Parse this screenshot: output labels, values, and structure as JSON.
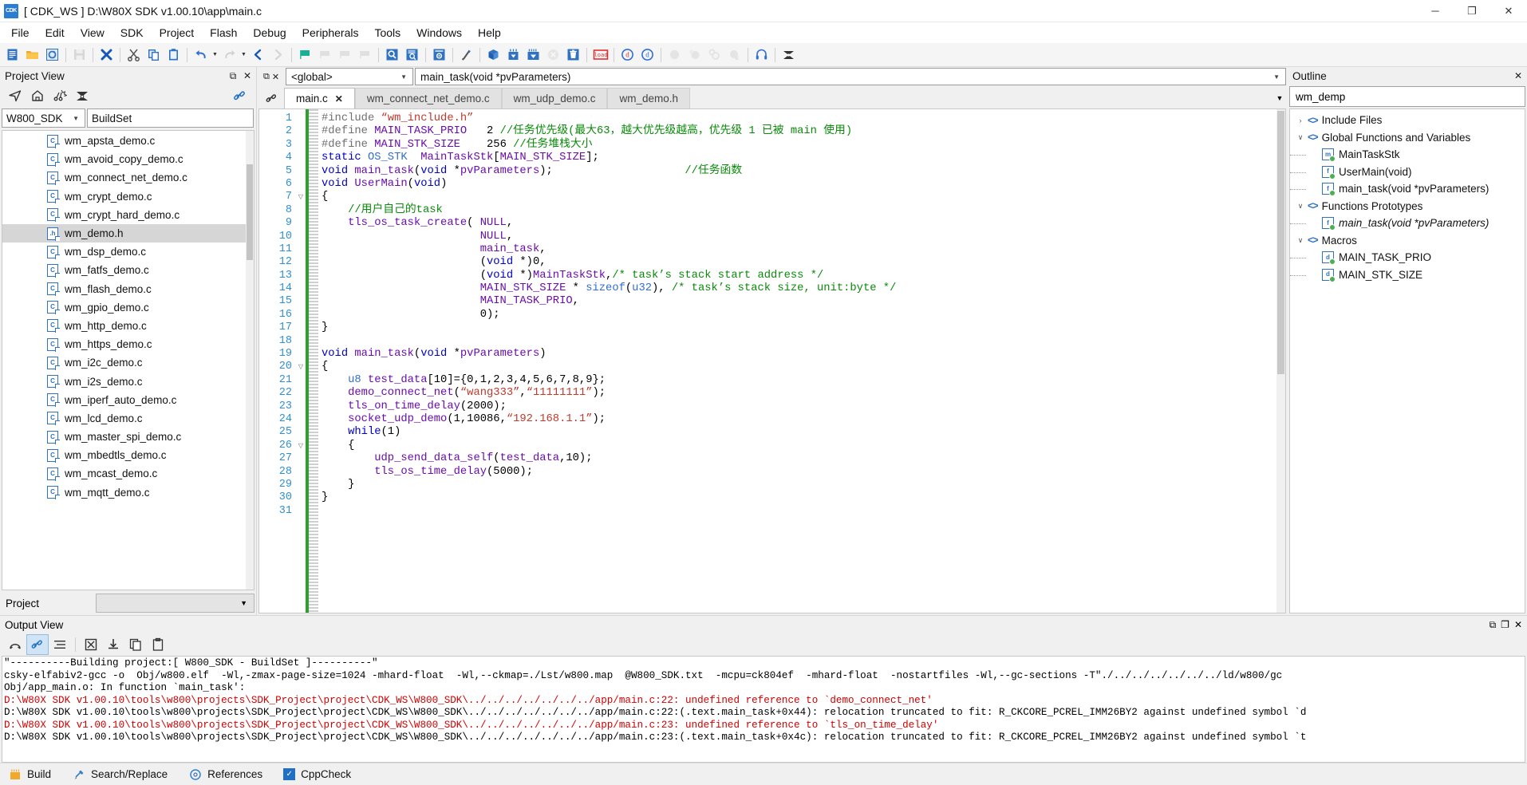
{
  "window": {
    "title": "[ CDK_WS ] D:\\W80X SDK v1.00.10\\app\\main.c",
    "app_icon_text": "CDK",
    "minimize": "─",
    "maximize": "❐",
    "close": "✕"
  },
  "menu": [
    "File",
    "Edit",
    "View",
    "SDK",
    "Project",
    "Flash",
    "Debug",
    "Peripherals",
    "Tools",
    "Windows",
    "Help"
  ],
  "project_view": {
    "title": "Project View",
    "dock_icon": "⧉",
    "close_icon": "✕",
    "toolbar": [
      "navigate-icon",
      "home-icon",
      "build-icon",
      "target-icon",
      "link-icon"
    ],
    "sdk_combo": "W800_SDK",
    "buildset_combo": "BuildSet",
    "bottom_label": "Project",
    "files": [
      {
        "name": "wm_apsta_demo.c",
        "type": "c",
        "selected": false
      },
      {
        "name": "wm_avoid_copy_demo.c",
        "type": "c",
        "selected": false
      },
      {
        "name": "wm_connect_net_demo.c",
        "type": "c",
        "selected": false
      },
      {
        "name": "wm_crypt_demo.c",
        "type": "c",
        "selected": false
      },
      {
        "name": "wm_crypt_hard_demo.c",
        "type": "c",
        "selected": false
      },
      {
        "name": "wm_demo.h",
        "type": "h",
        "selected": true
      },
      {
        "name": "wm_dsp_demo.c",
        "type": "c",
        "selected": false
      },
      {
        "name": "wm_fatfs_demo.c",
        "type": "c",
        "selected": false
      },
      {
        "name": "wm_flash_demo.c",
        "type": "c",
        "selected": false
      },
      {
        "name": "wm_gpio_demo.c",
        "type": "c",
        "selected": false
      },
      {
        "name": "wm_http_demo.c",
        "type": "c",
        "selected": false
      },
      {
        "name": "wm_https_demo.c",
        "type": "c",
        "selected": false
      },
      {
        "name": "wm_i2c_demo.c",
        "type": "c",
        "selected": false
      },
      {
        "name": "wm_i2s_demo.c",
        "type": "c",
        "selected": false
      },
      {
        "name": "wm_iperf_auto_demo.c",
        "type": "c",
        "selected": false
      },
      {
        "name": "wm_lcd_demo.c",
        "type": "c",
        "selected": false
      },
      {
        "name": "wm_master_spi_demo.c",
        "type": "c",
        "selected": false
      },
      {
        "name": "wm_mbedtls_demo.c",
        "type": "c",
        "selected": false
      },
      {
        "name": "wm_mcast_demo.c",
        "type": "c",
        "selected": false
      },
      {
        "name": "wm_mqtt_demo.c",
        "type": "c",
        "selected": false
      }
    ]
  },
  "editor": {
    "scope_combo": "<global>",
    "function_combo": "main_task(void *pvParameters)",
    "tabs": [
      {
        "label": "main.c",
        "active": true,
        "closable": true
      },
      {
        "label": "wm_connect_net_demo.c",
        "active": false,
        "closable": false
      },
      {
        "label": "wm_udp_demo.c",
        "active": false,
        "closable": false
      },
      {
        "label": "wm_demo.h",
        "active": false,
        "closable": false
      }
    ],
    "first_line": 1,
    "last_line": 31,
    "lines": [
      "#include “wm_include.h”",
      "#define MAIN_TASK_PRIO   2 //任务优先级(最大63，越大优先级越高，优先级 1 已被 main 使用)",
      "#define MAIN_STK_SIZE    256 //任务堆栈大小",
      "static OS_STK  MainTaskStk[MAIN_STK_SIZE];",
      "void main_task(void *pvParameters);                    //任务函数",
      "void UserMain(void)",
      "{",
      "    //用户自己的task",
      "    tls_os_task_create( NULL,",
      "                        NULL,",
      "                        main_task,",
      "                        (void *)0,",
      "                        (void *)MainTaskStk,/* task’s stack start address */",
      "                        MAIN_STK_SIZE * sizeof(u32), /* task’s stack size, unit:byte */",
      "                        MAIN_TASK_PRIO,",
      "                        0);",
      "}",
      "",
      "void main_task(void *pvParameters)",
      "{",
      "    u8 test_data[10]={0,1,2,3,4,5,6,7,8,9};",
      "    demo_connect_net(“wang333”,“11111111”);",
      "    tls_on_time_delay(2000);",
      "    socket_udp_demo(1,10086,“192.168.1.1”);",
      "    while(1)",
      "    {",
      "        udp_send_data_self(test_data,10);",
      "        tls_os_time_delay(5000);",
      "    }",
      "}",
      ""
    ]
  },
  "outline": {
    "title": "Outline",
    "dock_icon": "⧉",
    "close_icon": "✕",
    "search_value": "wm_demp",
    "items": [
      {
        "label": "Include Files",
        "level": 0,
        "expander": "›",
        "kind": "group"
      },
      {
        "label": "Global Functions and Variables",
        "level": 0,
        "expander": "∨",
        "kind": "group"
      },
      {
        "label": "MainTaskStk",
        "level": 1,
        "kind": "member",
        "badge": "m",
        "italic": false
      },
      {
        "label": "UserMain(void)",
        "level": 1,
        "kind": "member",
        "badge": "f",
        "italic": false
      },
      {
        "label": "main_task(void *pvParameters)",
        "level": 1,
        "kind": "member",
        "badge": "f",
        "italic": false
      },
      {
        "label": "Functions Prototypes",
        "level": 0,
        "expander": "∨",
        "kind": "group"
      },
      {
        "label": "main_task(void *pvParameters)",
        "level": 1,
        "kind": "member",
        "badge": "f",
        "italic": true
      },
      {
        "label": "Macros",
        "level": 0,
        "expander": "∨",
        "kind": "group"
      },
      {
        "label": "MAIN_TASK_PRIO",
        "level": 1,
        "kind": "member",
        "badge": "d",
        "italic": false
      },
      {
        "label": "MAIN_STK_SIZE",
        "level": 1,
        "kind": "member",
        "badge": "d",
        "italic": false
      }
    ]
  },
  "output_view": {
    "title": "Output View",
    "dock_icon": "⧉",
    "restore_icon": "❐",
    "close_icon": "✕",
    "toolbar": [
      "clear-icon",
      "pin-icon",
      "wrap-icon",
      "stop-icon",
      "save-icon",
      "copy-icon",
      "paste-icon"
    ],
    "lines": [
      {
        "text": "\"----------Building project:[ W800_SDK - BuildSet ]----------\"",
        "error": false
      },
      {
        "text": "csky-elfabiv2-gcc -o  Obj/w800.elf  -Wl,-zmax-page-size=1024 -mhard-float  -Wl,--ckmap=./Lst/w800.map  @W800_SDK.txt  -mcpu=ck804ef  -mhard-float  -nostartfiles -Wl,--gc-sections -T\"./../../../../../../ld/w800/gc",
        "error": false
      },
      {
        "text": "Obj/app_main.o: In function `main_task':",
        "error": false
      },
      {
        "text": "D:\\W80X SDK v1.00.10\\tools\\w800\\projects\\SDK_Project\\project\\CDK_WS\\W800_SDK\\../../../../../../../app/main.c:22: undefined reference to `demo_connect_net'",
        "error": true
      },
      {
        "text": "D:\\W80X SDK v1.00.10\\tools\\w800\\projects\\SDK_Project\\project\\CDK_WS\\W800_SDK\\../../../../../../../app/main.c:22:(.text.main_task+0x44): relocation truncated to fit: R_CKCORE_PCREL_IMM26BY2 against undefined symbol `d",
        "error": false
      },
      {
        "text": "D:\\W80X SDK v1.00.10\\tools\\w800\\projects\\SDK_Project\\project\\CDK_WS\\W800_SDK\\../../../../../../../app/main.c:23: undefined reference to `tls_on_time_delay'",
        "error": true
      },
      {
        "text": "D:\\W80X SDK v1.00.10\\tools\\w800\\projects\\SDK_Project\\project\\CDK_WS\\W800_SDK\\../../../../../../../app/main.c:23:(.text.main_task+0x4c): relocation truncated to fit: R_CKCORE_PCREL_IMM26BY2 against undefined symbol `t",
        "error": false
      }
    ]
  },
  "statusbar": {
    "items": [
      {
        "label": "Build",
        "icon": "build-icon"
      },
      {
        "label": "Search/Replace",
        "icon": "search-replace-icon"
      },
      {
        "label": "References",
        "icon": "references-icon"
      },
      {
        "label": "CppCheck",
        "icon": "cppcheck-icon"
      }
    ]
  },
  "colors": {
    "accent": "#2f72c4",
    "error": "#d00000",
    "comment": "#0a8a0a",
    "string": "#c0392b",
    "keyword": "#0000c8",
    "macro": "#6a0dad",
    "linenumber": "#2f8fd6",
    "changebar": "#2ca02c"
  }
}
